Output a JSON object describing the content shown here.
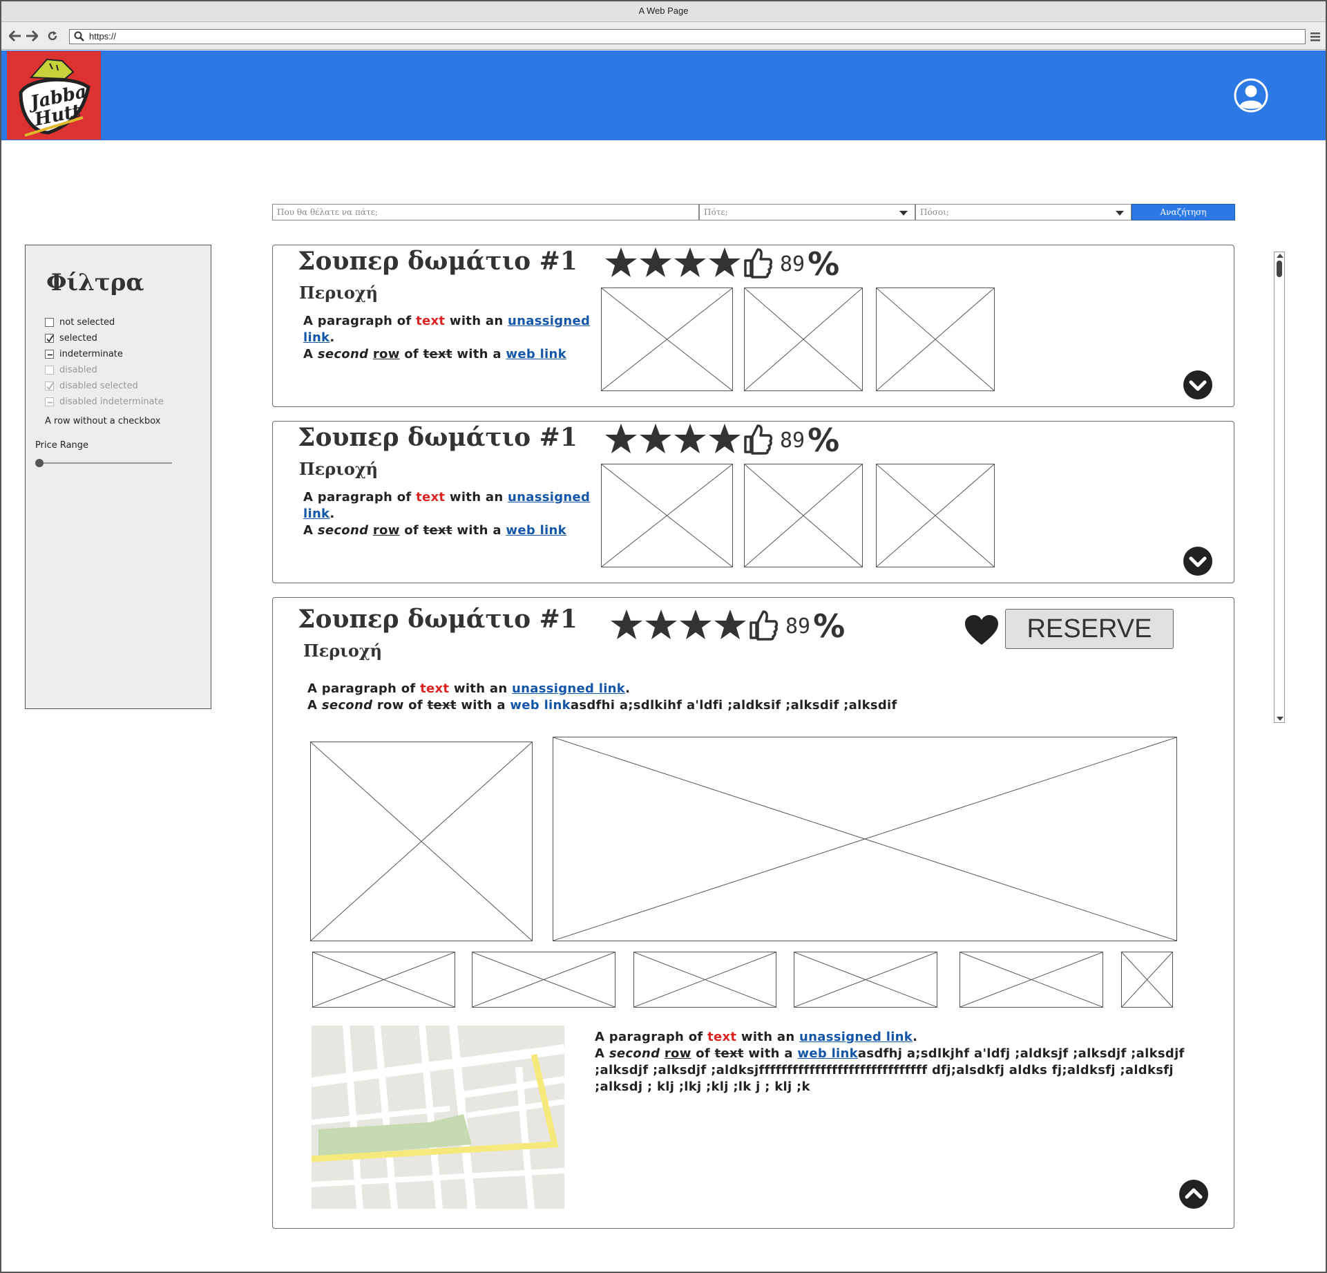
{
  "browser": {
    "window_title": "A Web Page",
    "url": "https://"
  },
  "header": {
    "logo_alt": "Jabba the Hutt",
    "brand_color": "#2c78e4",
    "logo_color": "#dc3232"
  },
  "search": {
    "where_placeholder": "Που θα θέλατε να πάτε;",
    "when_placeholder": "Πότε;",
    "howmany_placeholder": "Πόσοι;",
    "button_label": "Αναζήτηση"
  },
  "filters": {
    "title": "Φίλτρα",
    "options": [
      {
        "label": "not selected",
        "state": "unchecked",
        "disabled": false
      },
      {
        "label": "selected",
        "state": "checked",
        "disabled": false
      },
      {
        "label": "indeterminate",
        "state": "indeterminate",
        "disabled": false
      },
      {
        "label": "disabled",
        "state": "unchecked",
        "disabled": true
      },
      {
        "label": "disabled selected",
        "state": "checked",
        "disabled": true
      },
      {
        "label": "disabled indeterminate",
        "state": "indeterminate",
        "disabled": true
      }
    ],
    "plain_row": "A row without a checkbox",
    "price_label": "Price Range",
    "price_value": 0
  },
  "listings": [
    {
      "title": "Σουπερ δωμάτιο #1",
      "area": "Περιοχή",
      "stars": 4,
      "rating_percent": "89",
      "percent_sign": "%",
      "p1_a": "A paragraph of ",
      "p1_red": "text",
      "p1_b": " with an ",
      "p1_link": "unassigned link",
      "p1_end": ".",
      "p2_a": "A ",
      "p2_em": "second",
      "p2_ul": "row",
      "p2_of": " of ",
      "p2_strike": "text",
      "p2_with": " with a ",
      "p2_link": "web link"
    },
    {
      "title": "Σουπερ δωμάτιο #1",
      "area": "Περιοχή",
      "stars": 4,
      "rating_percent": "89",
      "percent_sign": "%",
      "p1_a": "A paragraph of ",
      "p1_red": "text",
      "p1_b": " with an ",
      "p1_link": "unassigned link",
      "p1_end": ".",
      "p2_a": "A ",
      "p2_em": "second",
      "p2_ul": "row",
      "p2_of": " of ",
      "p2_strike": "text",
      "p2_with": " with a ",
      "p2_link": "web link"
    }
  ],
  "expanded": {
    "title": "Σουπερ δωμάτιο #1",
    "area": "Περιοχή",
    "stars": 4,
    "rating_percent": "89",
    "percent_sign": "%",
    "reserve_label": "RESERVE",
    "p1_a": "A paragraph of ",
    "p1_red": "text",
    "p1_b": " with an ",
    "p1_link": "unassigned link",
    "p1_end": ".",
    "p2_a": "A ",
    "p2_em": "second",
    "p2_row": " row of ",
    "p2_strike": "text",
    "p2_with": " with a ",
    "p2_link": "web link",
    "p2_tail": "asdfhi a;sdlkihf a'ldfi ;aldksif ;alksdif ;alksdif",
    "d1_a": "A paragraph of ",
    "d1_red": "text",
    "d1_b": " with an ",
    "d1_link": "unassigned link",
    "d1_end": ".",
    "d2_a": "A ",
    "d2_em": "second",
    "d2_ul": "row",
    "d2_of": " of ",
    "d2_strike": "text",
    "d2_with": " with a ",
    "d2_link": "web link",
    "d2_tail": "asdfhj a;sdlkjhf a'ldfj ;aldksjf ;alksdjf ;alksdjf",
    "d3": ";alksdjf ;alksdjf ;aldksjffffffffffffffffffffffffffffff dfj;alsdkfj aldks fj;aldksfj ;aldksfj",
    "d4": ";alksdj ; klj  ;lkj  ;klj  ;lk j ; klj ;k"
  }
}
